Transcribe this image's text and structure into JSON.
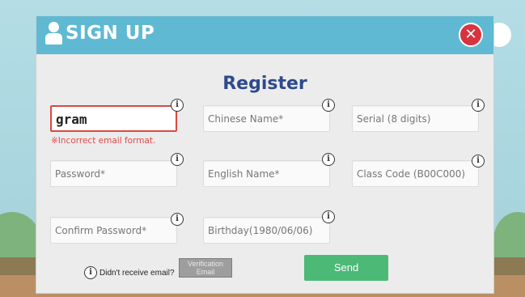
{
  "header": {
    "title": "SIGN UP",
    "close_label": "✕"
  },
  "form": {
    "heading": "Register",
    "email_value": "gram",
    "email_error": "※Incorrect email format.",
    "chinese_name_placeholder": "Chinese Name*",
    "serial_placeholder": "Serial (8 digits)",
    "password_placeholder": "Password*",
    "english_name_placeholder": "English Name*",
    "class_code_placeholder": "Class Code (B00C000)",
    "confirm_password_placeholder": "Confirm Password*",
    "birthday_placeholder": "Birthday(1980/06/06)",
    "info_glyph": "i"
  },
  "footer": {
    "didnt_receive_text": "Didn't receive email?",
    "verification_button": "Verification Email",
    "send_button": "Send"
  },
  "colors": {
    "header_bg": "#5fb9d3",
    "title_color": "#2e4a8e",
    "error_color": "#e0484a",
    "send_bg": "#4cb977",
    "close_bg": "#d8343f"
  }
}
